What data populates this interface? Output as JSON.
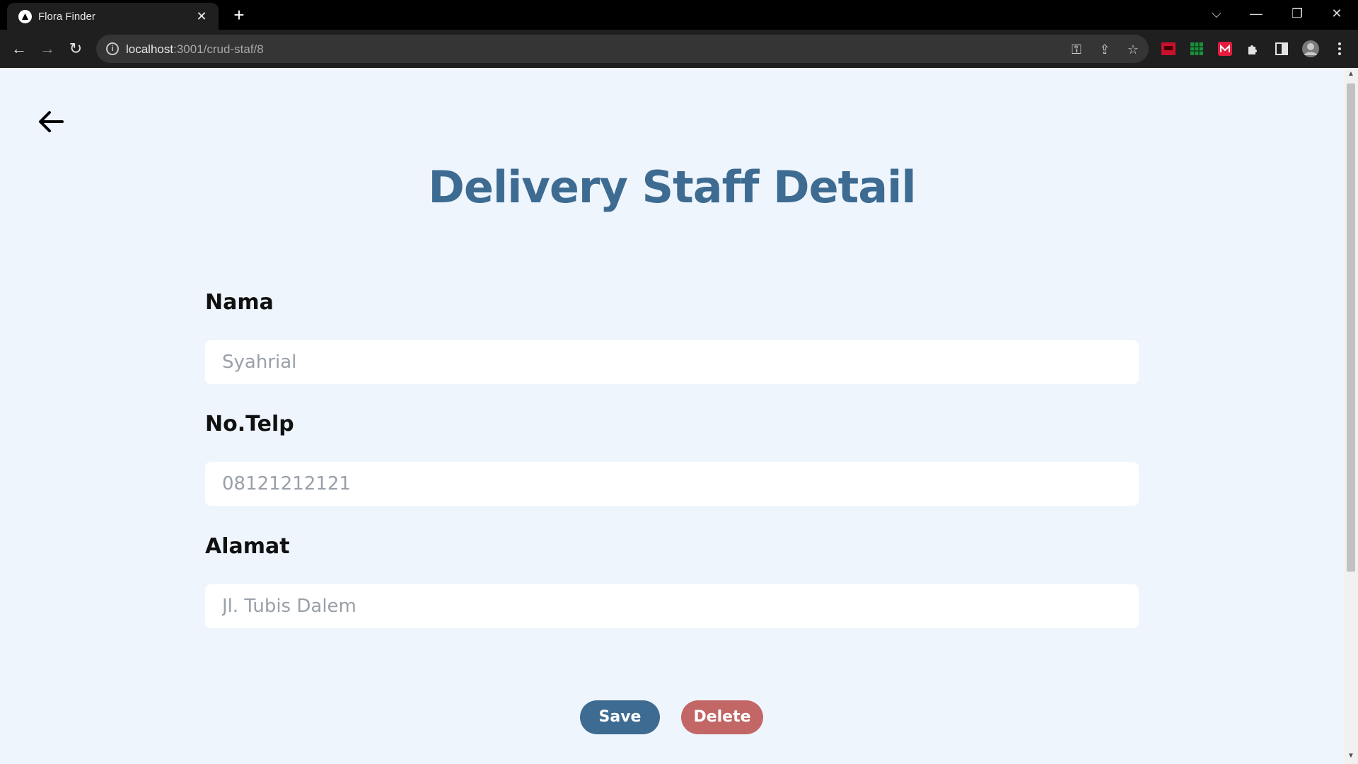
{
  "browser": {
    "tab_title": "Flora Finder",
    "tab_close": "✕",
    "new_tab": "+",
    "url_host": "localhost",
    "url_path": ":3001/crud-staf/8",
    "window_controls": {
      "dropdown": "⌵",
      "minimize": "—",
      "restore": "❐",
      "close": "✕"
    },
    "nav": {
      "back": "←",
      "forward": "→",
      "reload": "↻"
    },
    "omnibox_icons": {
      "key": "⚿",
      "share": "⇪",
      "star": "☆"
    },
    "extensions": [
      "red-extension",
      "green-extension",
      "red-m-extension",
      "puzzle-icon",
      "side-panel-icon",
      "profile-avatar",
      "menu-icon"
    ]
  },
  "page": {
    "title": "Delivery Staff Detail",
    "fields": [
      {
        "label": "Nama",
        "placeholder": "Syahrial"
      },
      {
        "label": "No.Telp",
        "placeholder": "08121212121"
      },
      {
        "label": "Alamat",
        "placeholder": "Jl. Tubis Dalem"
      }
    ],
    "buttons": {
      "save": "Save",
      "delete": "Delete"
    },
    "colors": {
      "background": "#eef5fd",
      "title": "#3d6b91",
      "save": "#3d6b91",
      "delete": "#c26666"
    }
  }
}
